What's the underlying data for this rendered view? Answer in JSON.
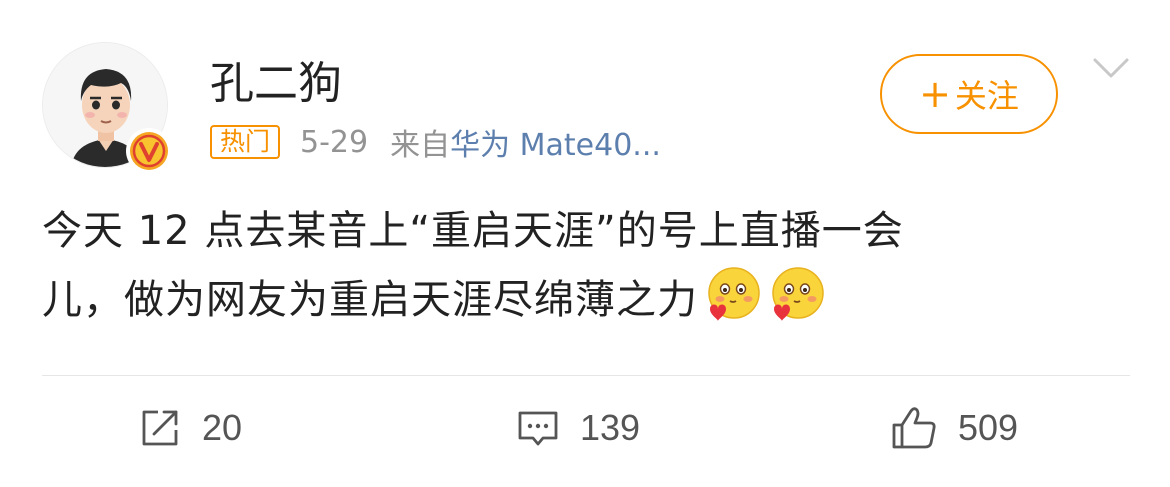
{
  "post": {
    "username": "孔二狗",
    "hot_tag": "热门",
    "date": "5-29",
    "source_prefix": "来自",
    "source": "华为 Mate40...",
    "content_line1": "今天 12 点去某音上“重启天涯”的号上直播一会",
    "content_line2": "儿，做为网友为重启天涯尽绵薄之力",
    "emojis": [
      "kiss-emoji",
      "kiss-emoji"
    ]
  },
  "follow_button": {
    "plus": "+",
    "label": "关注"
  },
  "actions": {
    "repost_count": "20",
    "comment_count": "139",
    "like_count": "509"
  },
  "colors": {
    "accent": "#f79100",
    "link": "#5d7fae",
    "muted": "#939393",
    "text": "#222222"
  }
}
